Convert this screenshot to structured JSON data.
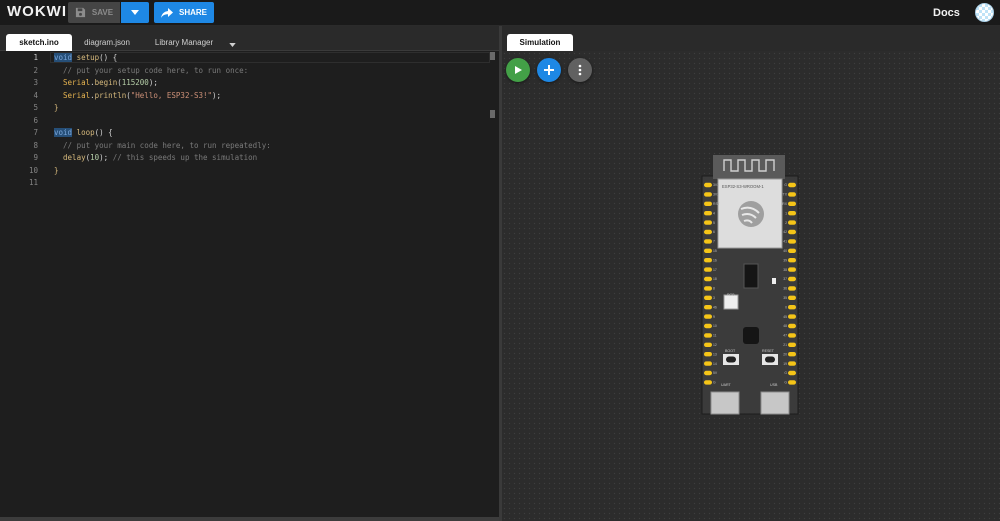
{
  "app": {
    "logo": "WOKWI"
  },
  "toolbar": {
    "save_label": "SAVE",
    "share_label": "SHARE",
    "docs_label": "Docs"
  },
  "editor": {
    "tabs": [
      {
        "label": "sketch.ino",
        "active": true
      },
      {
        "label": "diagram.json",
        "active": false
      },
      {
        "label": "Library Manager",
        "active": false
      }
    ],
    "line_numbers": [
      "1",
      "2",
      "3",
      "4",
      "5",
      "6",
      "7",
      "8",
      "9",
      "10",
      "11"
    ],
    "code": {
      "l1_kw": "void",
      "l1_fn": "setup",
      "l1_rest": "() {",
      "l2": "  // put your setup code here, to run once:",
      "l3_obj": "Serial",
      "l3_dot": ".",
      "l3_fn": "begin",
      "l3_open": "(",
      "l3_num": "115200",
      "l3_close": ");",
      "l4_obj": "Serial",
      "l4_dot": ".",
      "l4_fn": "println",
      "l4_open": "(",
      "l4_str": "\"Hello, ESP32-S3!\"",
      "l4_close": ");",
      "l5": "}",
      "l7_kw": "void",
      "l7_fn": "loop",
      "l7_rest": "() {",
      "l8": "  // put your main code here, to run repeatedly:",
      "l9_fn": "delay",
      "l9_open": "(",
      "l9_num": "10",
      "l9_close": "); ",
      "l9_cm": "// this speeds up the simulation",
      "l10": "}"
    }
  },
  "simulation": {
    "tab_label": "Simulation",
    "board": {
      "module_label": "ESP32-S3-WROOM-1",
      "rgb_label": "RGB",
      "boot_label": "BOOT",
      "reset_label": "RESET",
      "uart_label": "UART",
      "usb_label": "USB",
      "left_pins": [
        "3V3",
        "3V3",
        "RST",
        "4",
        "5",
        "6",
        "7",
        "15",
        "16",
        "17",
        "18",
        "8",
        "3",
        "46",
        "9",
        "10",
        "11",
        "12",
        "13",
        "14",
        "5V",
        "G"
      ],
      "right_pins": [
        "G",
        "TX",
        "RX",
        "1",
        "2",
        "42",
        "41",
        "40",
        "39",
        "38",
        "37",
        "36",
        "35",
        "0",
        "45",
        "48",
        "47",
        "21",
        "20",
        "19",
        "G",
        "G"
      ]
    }
  },
  "colors": {
    "accent": "#1e88e5",
    "play": "#43a047",
    "pin": "#f5c518",
    "board": "#3a3a3a"
  }
}
